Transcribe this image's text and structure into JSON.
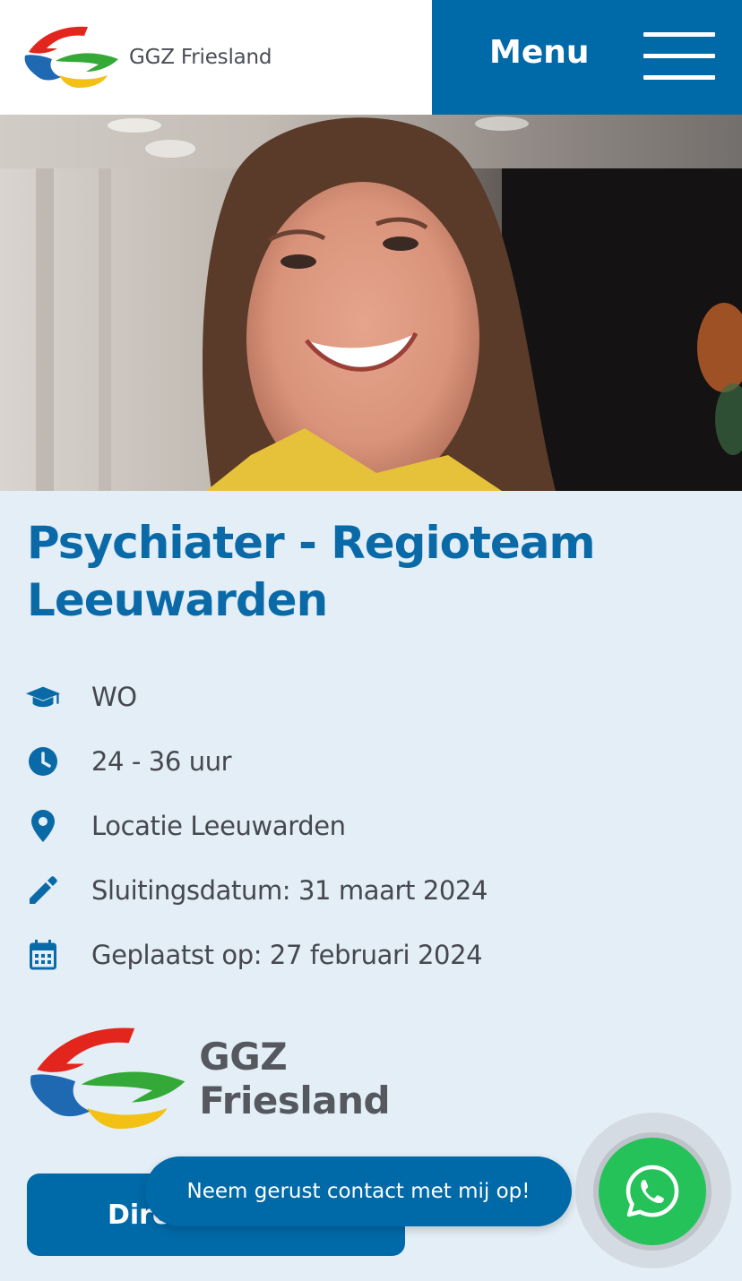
{
  "header": {
    "brand": "GGZ Friesland",
    "menu_label": "Menu"
  },
  "colors": {
    "primary": "#0069a7",
    "title": "#0a6aa8",
    "background": "#e4eef6",
    "whatsapp": "#25c25a"
  },
  "job": {
    "title": "Psychiater - Regioteam Leeuwarden",
    "facts": [
      {
        "icon": "graduation-cap-icon",
        "text": "WO"
      },
      {
        "icon": "clock-icon",
        "text": "24 - 36 uur"
      },
      {
        "icon": "map-pin-icon",
        "text": "Locatie Leeuwarden"
      },
      {
        "icon": "pencil-icon",
        "text": "Sluitingsdatum: 31 maart 2024"
      },
      {
        "icon": "calendar-icon",
        "text": "Geplaatst op: 27 februari 2024"
      }
    ]
  },
  "employer": {
    "brand": "GGZ Friesland"
  },
  "actions": {
    "apply_label": "Dire"
  },
  "chat": {
    "bubble_text": "Neem gerust contact met mij op!",
    "icon": "whatsapp-icon"
  }
}
